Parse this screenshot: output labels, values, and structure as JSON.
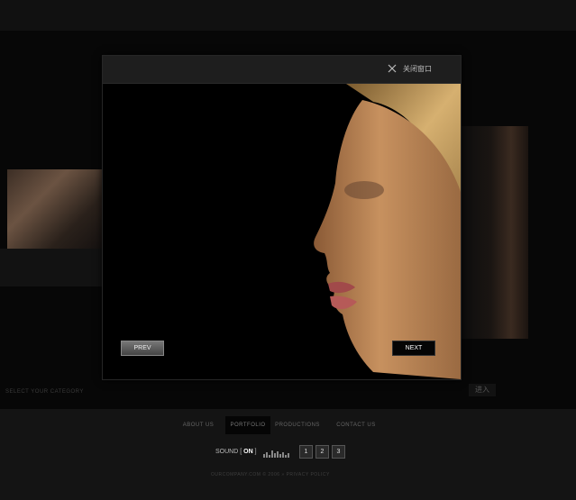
{
  "header": {
    "text": "···· ··· ·· ···· ·· ··· ······ ···· ·····"
  },
  "background": {
    "caption": "SELECT YOUR CATEGORY",
    "right_button": "进入"
  },
  "modal": {
    "close_label": "关闭窗口",
    "prev_label": "PREV",
    "next_label": "NEXT"
  },
  "footer": {
    "nav": [
      "ABOUT US",
      "PORTFOLIO",
      "PRODUCTIONS",
      "CONTACT US"
    ],
    "sound_label": "SOUND",
    "sound_state": "ON",
    "pages": [
      "1",
      "2",
      "3"
    ],
    "copyright": "OURCOMPANY.COM © 2006 » PRIVACY POLICY"
  },
  "colors": {
    "background": "#0b0b0b",
    "modal": "#000000",
    "accent": "#ffffff"
  }
}
